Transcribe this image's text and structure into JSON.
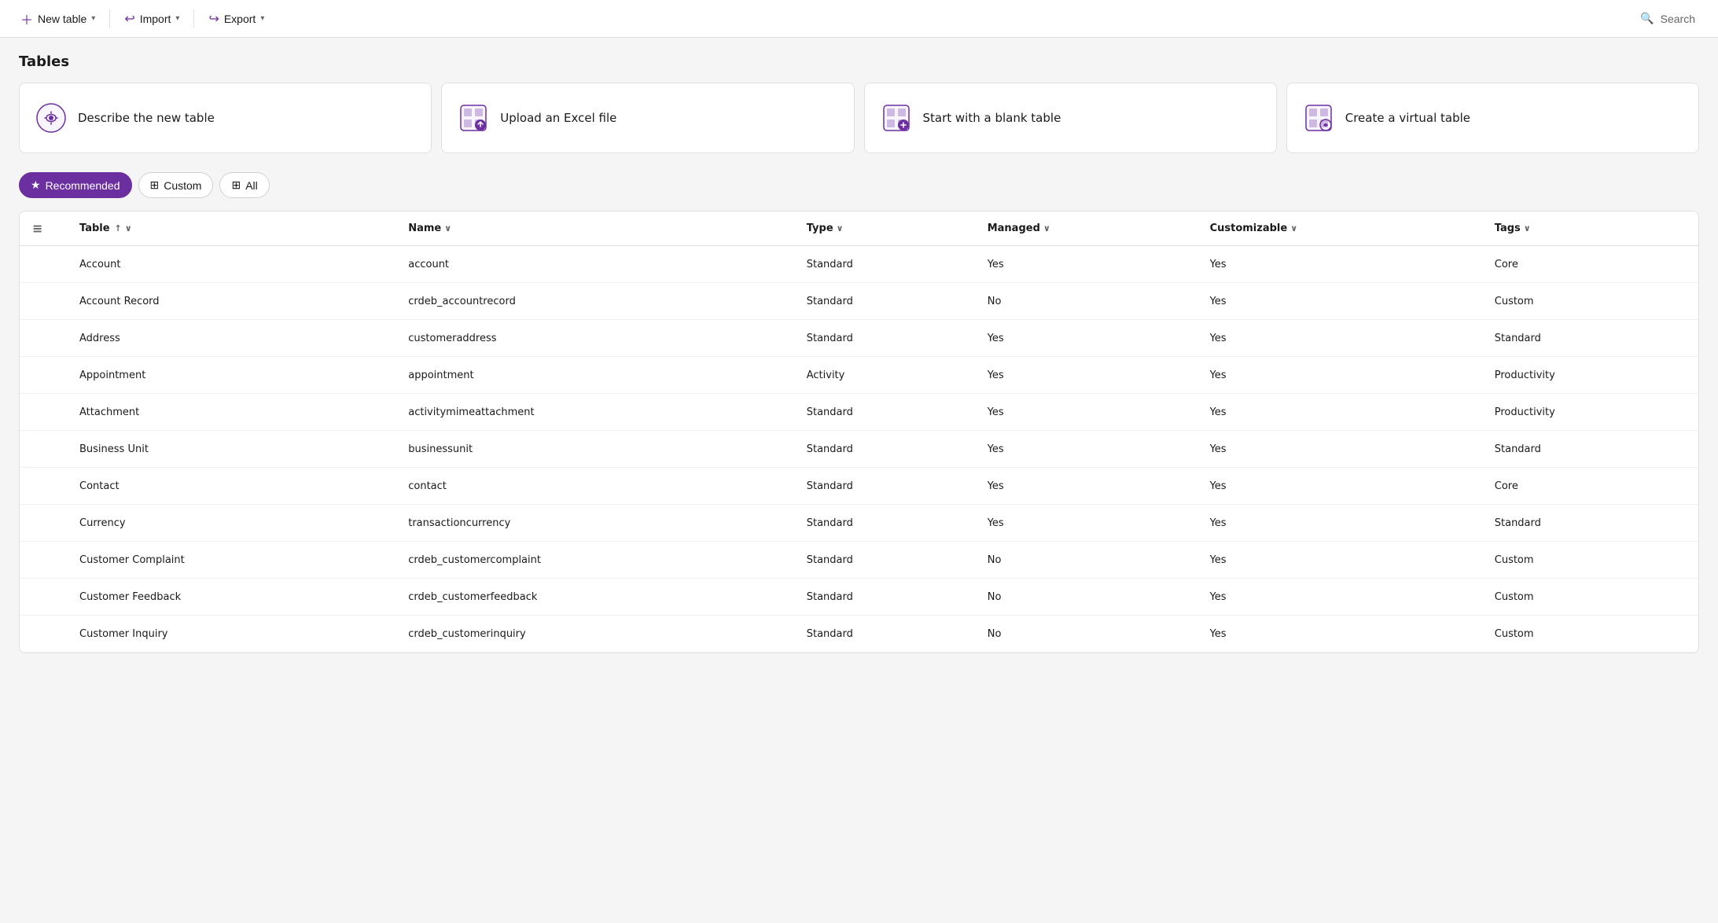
{
  "toolbar": {
    "new_table": "New table",
    "import": "Import",
    "export": "Export",
    "search": "Search"
  },
  "page": {
    "title": "Tables"
  },
  "action_cards": [
    {
      "id": "describe",
      "label": "Describe the new table",
      "icon": "ai"
    },
    {
      "id": "upload",
      "label": "Upload an Excel file",
      "icon": "excel"
    },
    {
      "id": "blank",
      "label": "Start with a blank table",
      "icon": "blank"
    },
    {
      "id": "virtual",
      "label": "Create a virtual table",
      "icon": "virtual"
    }
  ],
  "filters": [
    {
      "id": "recommended",
      "label": "Recommended",
      "active": true
    },
    {
      "id": "custom",
      "label": "Custom",
      "active": false
    },
    {
      "id": "all",
      "label": "All",
      "active": false
    }
  ],
  "table": {
    "columns": [
      {
        "id": "table",
        "label": "Table",
        "sortable": true,
        "sort": "asc",
        "filterable": true
      },
      {
        "id": "name",
        "label": "Name",
        "sortable": true,
        "filterable": true
      },
      {
        "id": "type",
        "label": "Type",
        "sortable": true,
        "filterable": true
      },
      {
        "id": "managed",
        "label": "Managed",
        "sortable": true,
        "filterable": true
      },
      {
        "id": "customizable",
        "label": "Customizable",
        "sortable": true,
        "filterable": true
      },
      {
        "id": "tags",
        "label": "Tags",
        "sortable": true,
        "filterable": true
      }
    ],
    "rows": [
      {
        "table": "Account",
        "name": "account",
        "type": "Standard",
        "managed": "Yes",
        "customizable": "Yes",
        "tags": "Core"
      },
      {
        "table": "Account Record",
        "name": "crdeb_accountrecord",
        "type": "Standard",
        "managed": "No",
        "customizable": "Yes",
        "tags": "Custom"
      },
      {
        "table": "Address",
        "name": "customeraddress",
        "type": "Standard",
        "managed": "Yes",
        "customizable": "Yes",
        "tags": "Standard"
      },
      {
        "table": "Appointment",
        "name": "appointment",
        "type": "Activity",
        "managed": "Yes",
        "customizable": "Yes",
        "tags": "Productivity"
      },
      {
        "table": "Attachment",
        "name": "activitymimeattachment",
        "type": "Standard",
        "managed": "Yes",
        "customizable": "Yes",
        "tags": "Productivity"
      },
      {
        "table": "Business Unit",
        "name": "businessunit",
        "type": "Standard",
        "managed": "Yes",
        "customizable": "Yes",
        "tags": "Standard"
      },
      {
        "table": "Contact",
        "name": "contact",
        "type": "Standard",
        "managed": "Yes",
        "customizable": "Yes",
        "tags": "Core"
      },
      {
        "table": "Currency",
        "name": "transactioncurrency",
        "type": "Standard",
        "managed": "Yes",
        "customizable": "Yes",
        "tags": "Standard"
      },
      {
        "table": "Customer Complaint",
        "name": "crdeb_customercomplaint",
        "type": "Standard",
        "managed": "No",
        "customizable": "Yes",
        "tags": "Custom"
      },
      {
        "table": "Customer Feedback",
        "name": "crdeb_customerfeedback",
        "type": "Standard",
        "managed": "No",
        "customizable": "Yes",
        "tags": "Custom"
      },
      {
        "table": "Customer Inquiry",
        "name": "crdeb_customerinquiry",
        "type": "Standard",
        "managed": "No",
        "customizable": "Yes",
        "tags": "Custom"
      }
    ]
  },
  "colors": {
    "purple": "#6b2fa0",
    "purple_light": "#f9f5ff"
  }
}
